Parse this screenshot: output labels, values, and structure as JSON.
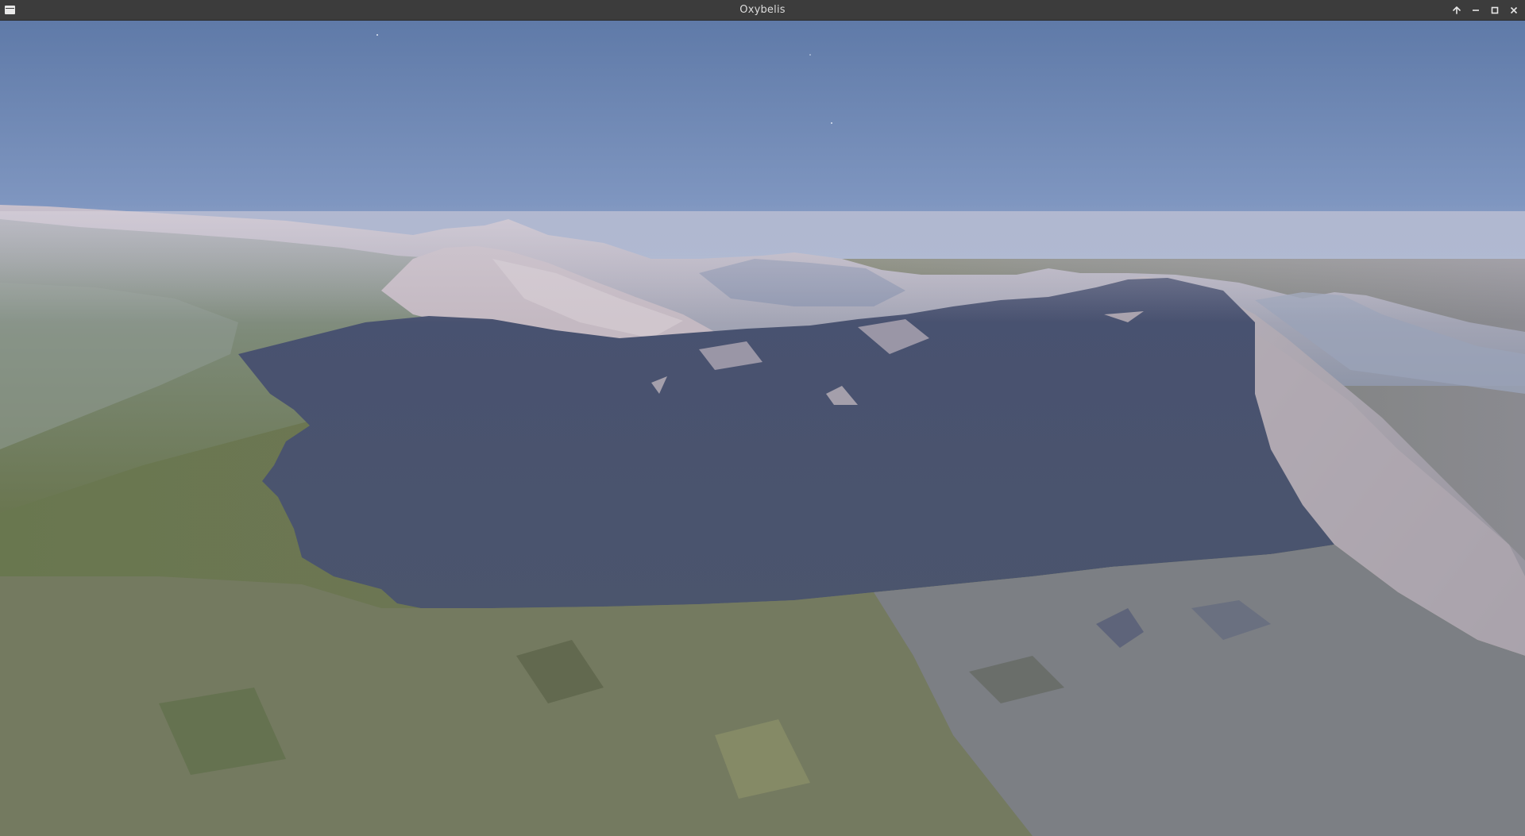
{
  "window": {
    "title": "Oxybelis",
    "controls": [
      {
        "name": "keep-above-button",
        "icon": "arrow-up-icon"
      },
      {
        "name": "minimize-button",
        "icon": "minimize-icon"
      },
      {
        "name": "maximize-button",
        "icon": "maximize-icon"
      },
      {
        "name": "close-button",
        "icon": "close-icon"
      }
    ]
  },
  "scene": {
    "description_kind": "rendered-terrain",
    "colors": {
      "sky_top": "#5f7aa8",
      "sky_horizon": "#c9c9d6",
      "haze": "#d8cfd6",
      "snow": "#c9bfc6",
      "rock_light": "#a9a3ac",
      "shadow": "#4a5370",
      "grass": "#6d7a55",
      "grass_light": "#8a8f63",
      "slope_gray": "#80838a"
    }
  }
}
